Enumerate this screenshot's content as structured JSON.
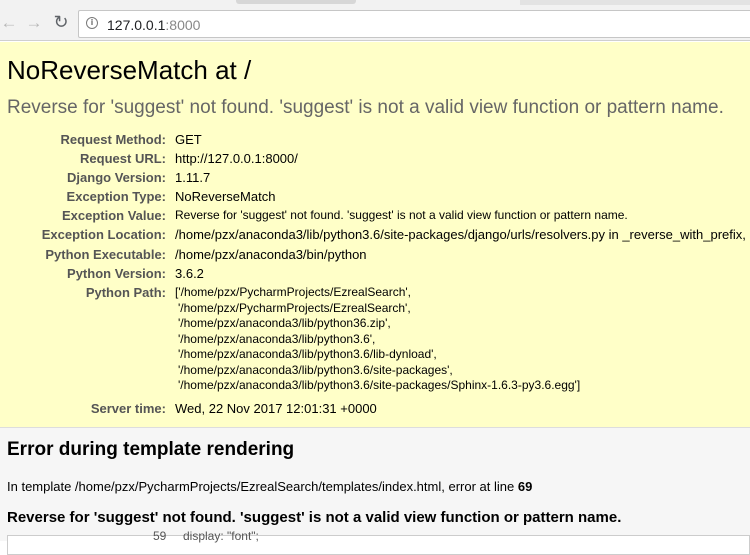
{
  "browser": {
    "url_host": "127.0.0.1",
    "url_port": ":8000",
    "back_glyph": "←",
    "forward_glyph": "→",
    "reload_glyph": "↻",
    "info_glyph": "i"
  },
  "summary": {
    "title": "NoReverseMatch at /",
    "message": "Reverse for 'suggest' not found. 'suggest' is not a valid view function or pattern name.",
    "meta": [
      {
        "key": "Request Method:",
        "value": "GET"
      },
      {
        "key": "Request URL:",
        "value": "http://127.0.0.1:8000/"
      },
      {
        "key": "Django Version:",
        "value": "1.11.7"
      },
      {
        "key": "Exception Type:",
        "value": "NoReverseMatch"
      },
      {
        "key": "Exception Value:",
        "value": "Reverse for 'suggest' not found. 'suggest' is not a valid view function or pattern name."
      },
      {
        "key": "Exception Location:",
        "value": "/home/pzx/anaconda3/lib/python3.6/site-packages/django/urls/resolvers.py in _reverse_with_prefix,"
      },
      {
        "key": "Python Executable:",
        "value": "/home/pzx/anaconda3/bin/python"
      },
      {
        "key": "Python Version:",
        "value": "3.6.2"
      },
      {
        "key": "Python Path:",
        "value": ""
      },
      {
        "key": "Server time:",
        "value": "Wed, 22 Nov 2017 12:01:31 +0000"
      }
    ],
    "python_path": [
      "['/home/pzx/PycharmProjects/EzrealSearch',",
      "'/home/pzx/PycharmProjects/EzrealSearch',",
      "'/home/pzx/anaconda3/lib/python36.zip',",
      "'/home/pzx/anaconda3/lib/python3.6',",
      "'/home/pzx/anaconda3/lib/python3.6/lib-dynload',",
      "'/home/pzx/anaconda3/lib/python3.6/site-packages',",
      "'/home/pzx/anaconda3/lib/python3.6/site-packages/Sphinx-1.6.3-py3.6.egg']"
    ]
  },
  "template": {
    "heading": "Error during template rendering",
    "line_prefix": "In template /home/pzx/PycharmProjects/EzrealSearch/templates/index.html, error at line",
    "line_number": "69",
    "message": "Reverse for 'suggest' not found. 'suggest' is not a valid view function or pattern name.",
    "code_lineno": "59",
    "code_snippet": "display: \"font\";"
  }
}
